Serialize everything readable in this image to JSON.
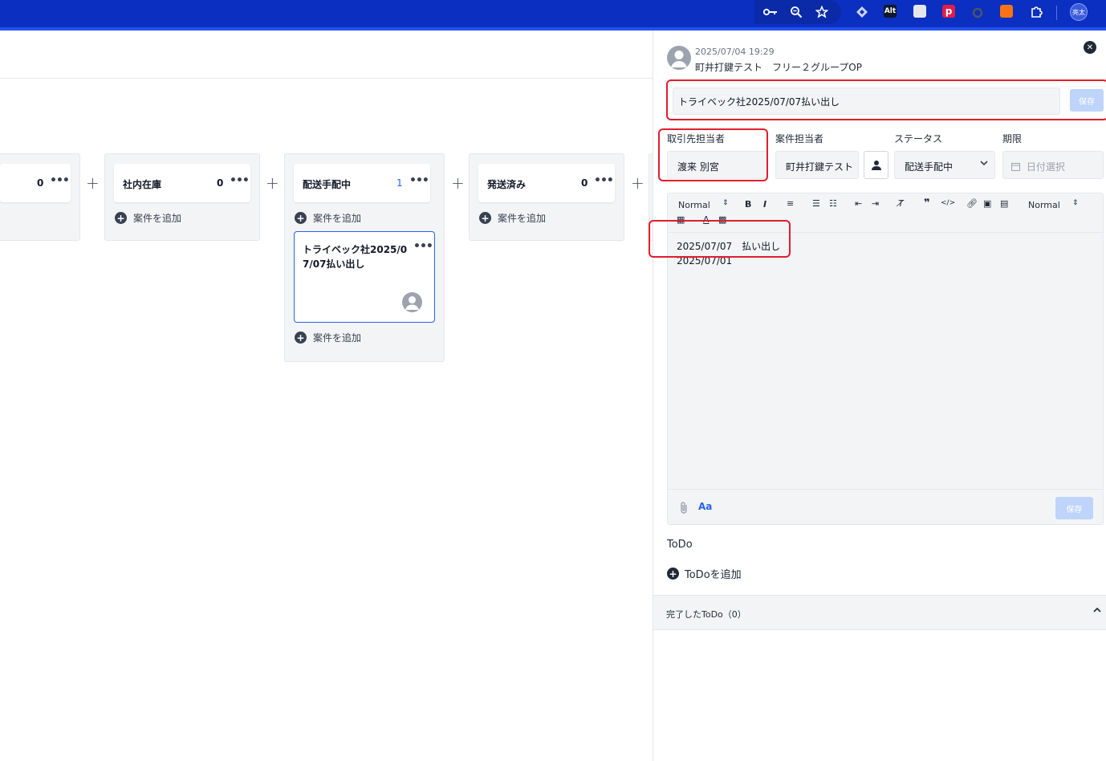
{
  "browser": {
    "extensions": [
      "key-icon",
      "zoom-icon",
      "star-icon",
      "ext-diamond-icon",
      "ext-alt-icon",
      "ext-clipboard-icon",
      "ext-p-icon",
      "ext-circle-icon",
      "ext-orange-icon",
      "puzzle-icon"
    ],
    "alt_label": "Alt",
    "p_label": "p",
    "profile_label": "亮太"
  },
  "board": {
    "columns": [
      {
        "title": "",
        "count": "0"
      },
      {
        "title": "社内在庫",
        "count": "0"
      },
      {
        "title": "配送手配中",
        "count": "1"
      },
      {
        "title": "発送済み",
        "count": "0"
      }
    ],
    "add_label": "案件を追加",
    "card": {
      "title": "トライベック社2025/07/07払い出し"
    }
  },
  "panel": {
    "date": "2025/07/04 19:29",
    "author": "町井打鍵テスト　フリー２グループOP",
    "title_value": "トライベック社2025/07/07払い出し",
    "save_label": "保存",
    "fields": {
      "client_label": "取引先担当者",
      "client_value": "渡来 別宮",
      "owner_label": "案件担当者",
      "owner_value": "町井打鍵テスト",
      "status_label": "ステータス",
      "status_value": "配送手配中",
      "due_label": "期限",
      "due_placeholder": "日付選択"
    },
    "editor": {
      "font_select": "Normal",
      "size_select": "Normal",
      "line1": "2025/07/07　払い出し",
      "line2": "2025/07/01",
      "aa_label": "Aa",
      "save_label": "保存"
    },
    "todo": {
      "heading": "ToDo",
      "add_label": "ToDoを追加",
      "done_label": "完了したToDo（0）"
    }
  },
  "colors": {
    "accent": "#2563eb",
    "browser_bar": "#0b2fc0",
    "highlight": "#e11d2d"
  }
}
